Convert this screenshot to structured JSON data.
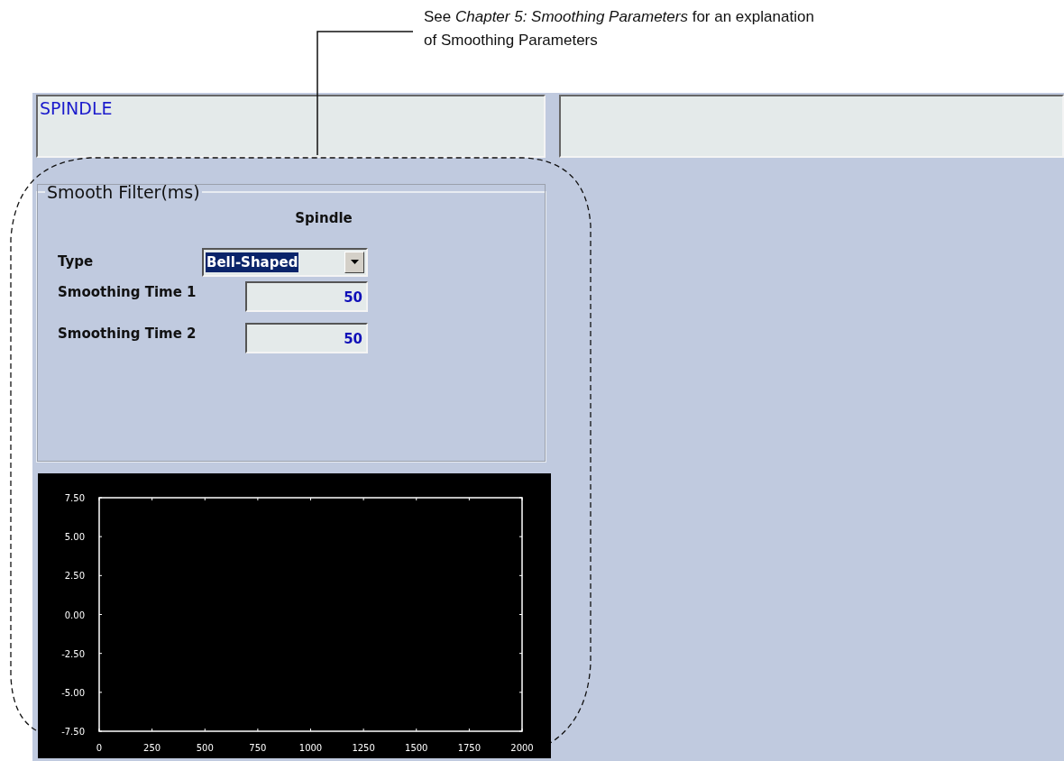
{
  "annotation": {
    "text": "See *Chapter 5: Smoothing Parameters* for an explanation of Smoothing Parameters"
  },
  "header": {
    "title": "SPINDLE"
  },
  "filter": {
    "title": "Smooth Filter(ms)",
    "column_heading": "Spindle",
    "fields": [
      {
        "kind": "dropdown",
        "label": "Type",
        "value": "Bell-Shaped"
      },
      {
        "kind": "number",
        "label": "Smoothing Time 1",
        "value": "50"
      },
      {
        "kind": "number",
        "label": "Smoothing Time 2",
        "value": "50"
      }
    ]
  },
  "chart": {
    "chart_data": {
      "type": "line",
      "xlim": [
        0,
        2000
      ],
      "ylim": [
        -7.5,
        7.5
      ],
      "xticks": [
        0,
        250,
        500,
        750,
        1000,
        1250,
        1500,
        1750,
        2000
      ],
      "yticks": [
        {
          "value": 7.5,
          "label": "7.50"
        },
        {
          "value": 5,
          "label": "5.00"
        },
        {
          "value": 2.5,
          "label": "2.50"
        },
        {
          "value": 0,
          "label": "0.00"
        },
        {
          "value": -2.5,
          "label": "-2.50"
        },
        {
          "value": -5,
          "label": "-5.00"
        },
        {
          "value": -7.5,
          "label": "-7.50"
        }
      ]
    }
  }
}
